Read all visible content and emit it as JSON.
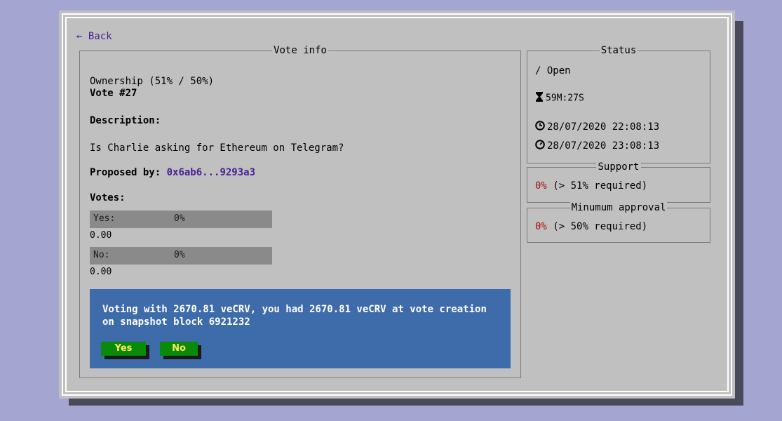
{
  "nav": {
    "back_label": "← Back"
  },
  "vote_info": {
    "title": "Vote info",
    "ownership": "Ownership (51% / 50%)",
    "vote_number": "Vote #27",
    "description_label": "Description:",
    "description": "Is Charlie asking for Ethereum on Telegram?",
    "proposed_by_label": "Proposed by:",
    "proposed_by_address": "0x6ab6...9293a3",
    "votes_label": "Votes:",
    "yes": {
      "label": "Yes:",
      "percent": "0%",
      "amount": "0.00"
    },
    "no": {
      "label": "No:",
      "percent": "0%",
      "amount": "0.00"
    },
    "voting_message": "Voting with 2670.81 veCRV, you had 2670.81 veCRV at vote creation on snapshot block 6921232",
    "yes_button": "Yes",
    "no_button": "No"
  },
  "status": {
    "title": "Status",
    "state": "/ Open",
    "time_left": "59M:27S",
    "start_time": "28/07/2020 22:08:13",
    "end_time": "28/07/2020 23:08:13"
  },
  "support": {
    "title": "Support",
    "value": "0%",
    "requirement": "(> 51% required)"
  },
  "approval": {
    "title": "Minumum approval",
    "value": "0%",
    "requirement": "(> 50% required)"
  },
  "colors": {
    "page_background": "#a5a5d2",
    "window_background": "#c0c0c0",
    "link": "#4b1f96",
    "percent_red": "#a81010",
    "vote_panel": "#3e6ba9",
    "button_green": "#0a8a0a",
    "button_text": "#ffe85a"
  }
}
